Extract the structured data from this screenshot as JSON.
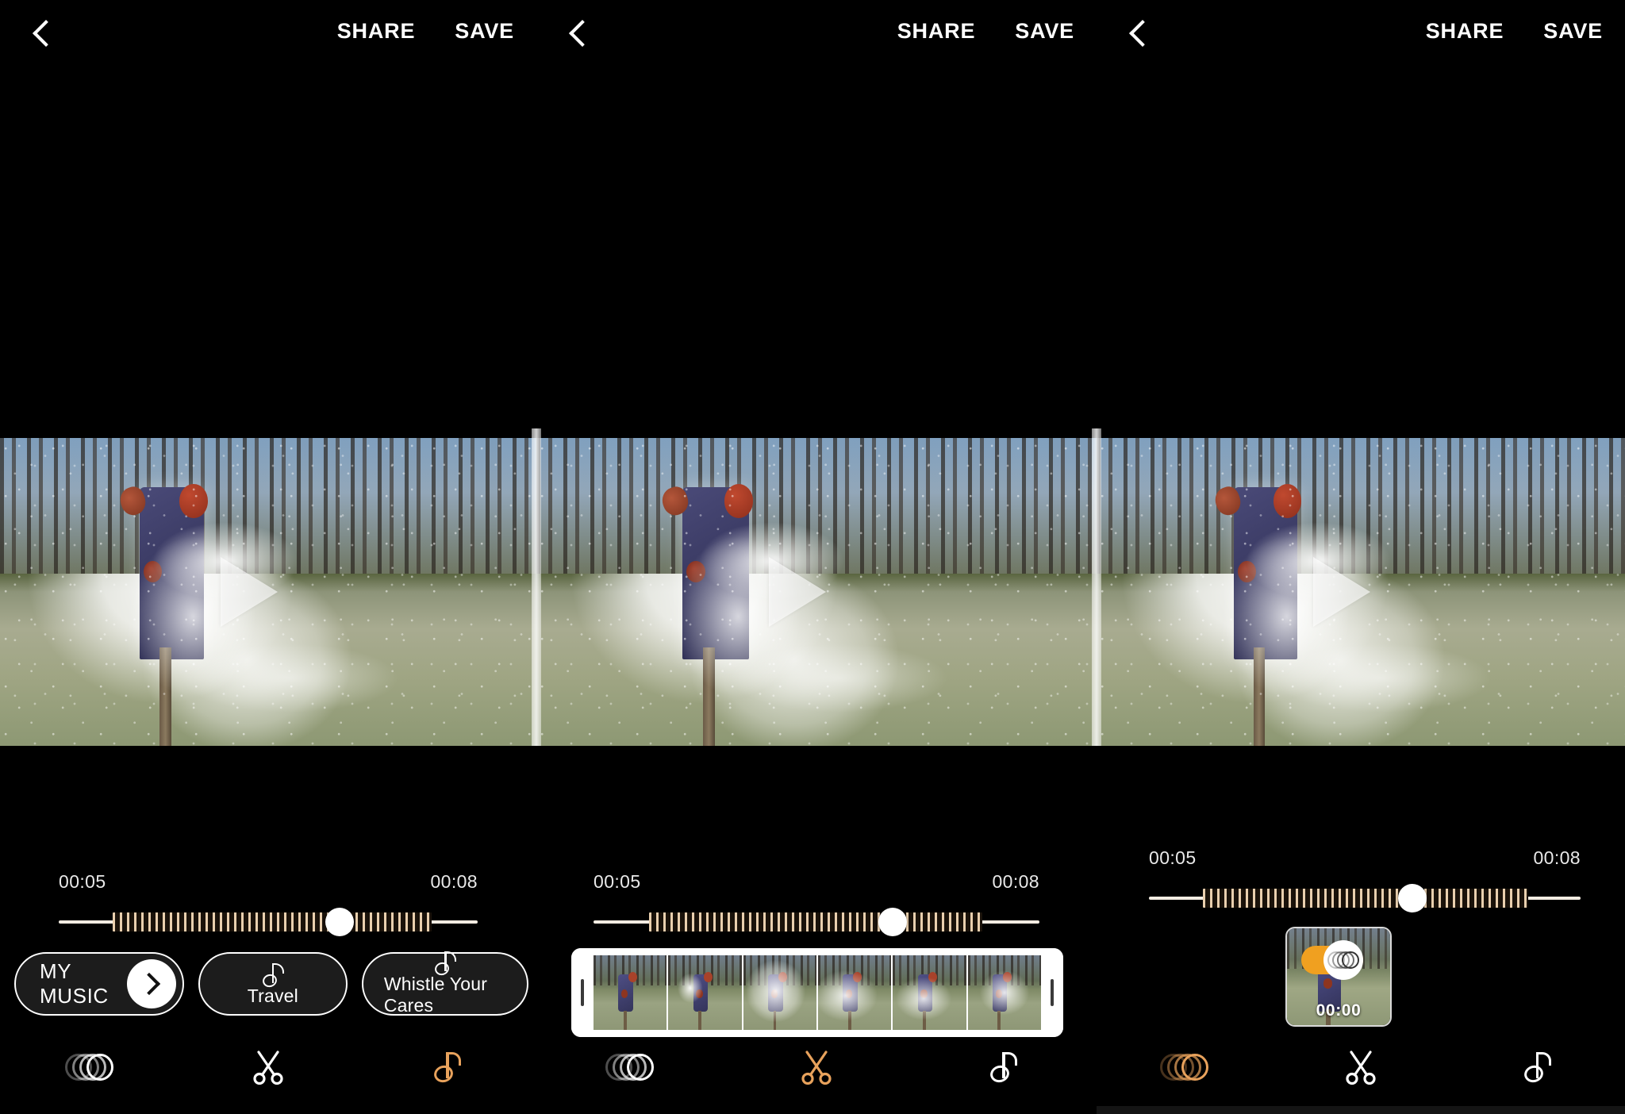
{
  "app": {
    "background": "#000000",
    "accent": "#e8a25c",
    "toggle_orange": "#f0a020"
  },
  "topbar": {
    "back_icon": "chevron-left-icon",
    "share_label": "SHARE",
    "save_label": "SAVE"
  },
  "preview": {
    "play_icon": "play-triangle-icon"
  },
  "panels": [
    {
      "id": "music-panel",
      "timeline": {
        "start_time": "00:05",
        "end_time": "00:08",
        "knob_percent": 67
      },
      "music": {
        "my_music_label": "MY MUSIC",
        "my_music_arrow_icon": "chevron-right-icon",
        "tracks": [
          {
            "name": "Travel",
            "icon": "music-note-icon"
          },
          {
            "name": "Whistle Your Cares",
            "icon": "music-note-icon"
          }
        ]
      },
      "toolbar": [
        {
          "name": "filter-tool",
          "icon": "filter-rings-icon",
          "active": false
        },
        {
          "name": "trim-tool",
          "icon": "scissors-icon",
          "active": false
        },
        {
          "name": "music-tool",
          "icon": "music-note-icon",
          "active": true
        }
      ]
    },
    {
      "id": "trim-panel",
      "timeline": {
        "start_time": "00:05",
        "end_time": "00:08",
        "knob_percent": 67
      },
      "filmstrip": {
        "left_handle_icon": "trim-handle-left-icon",
        "right_handle_icon": "trim-handle-right-icon",
        "frame_count": 6
      },
      "toolbar": [
        {
          "name": "filter-tool",
          "icon": "filter-rings-icon",
          "active": false
        },
        {
          "name": "trim-tool",
          "icon": "scissors-icon",
          "active": true
        },
        {
          "name": "music-tool",
          "icon": "music-note-icon",
          "active": false
        }
      ]
    },
    {
      "id": "filter-panel",
      "timeline": {
        "start_time": "00:05",
        "end_time": "00:08",
        "knob_percent": 61
      },
      "filter_thumb": {
        "time_label": "00:00",
        "toggle_icon": "filter-rings-icon",
        "toggle_state": "on"
      },
      "toolbar": [
        {
          "name": "filter-tool",
          "icon": "filter-rings-icon",
          "active": true
        },
        {
          "name": "trim-tool",
          "icon": "scissors-icon",
          "active": false
        },
        {
          "name": "music-tool",
          "icon": "music-note-icon",
          "active": false
        }
      ]
    }
  ]
}
